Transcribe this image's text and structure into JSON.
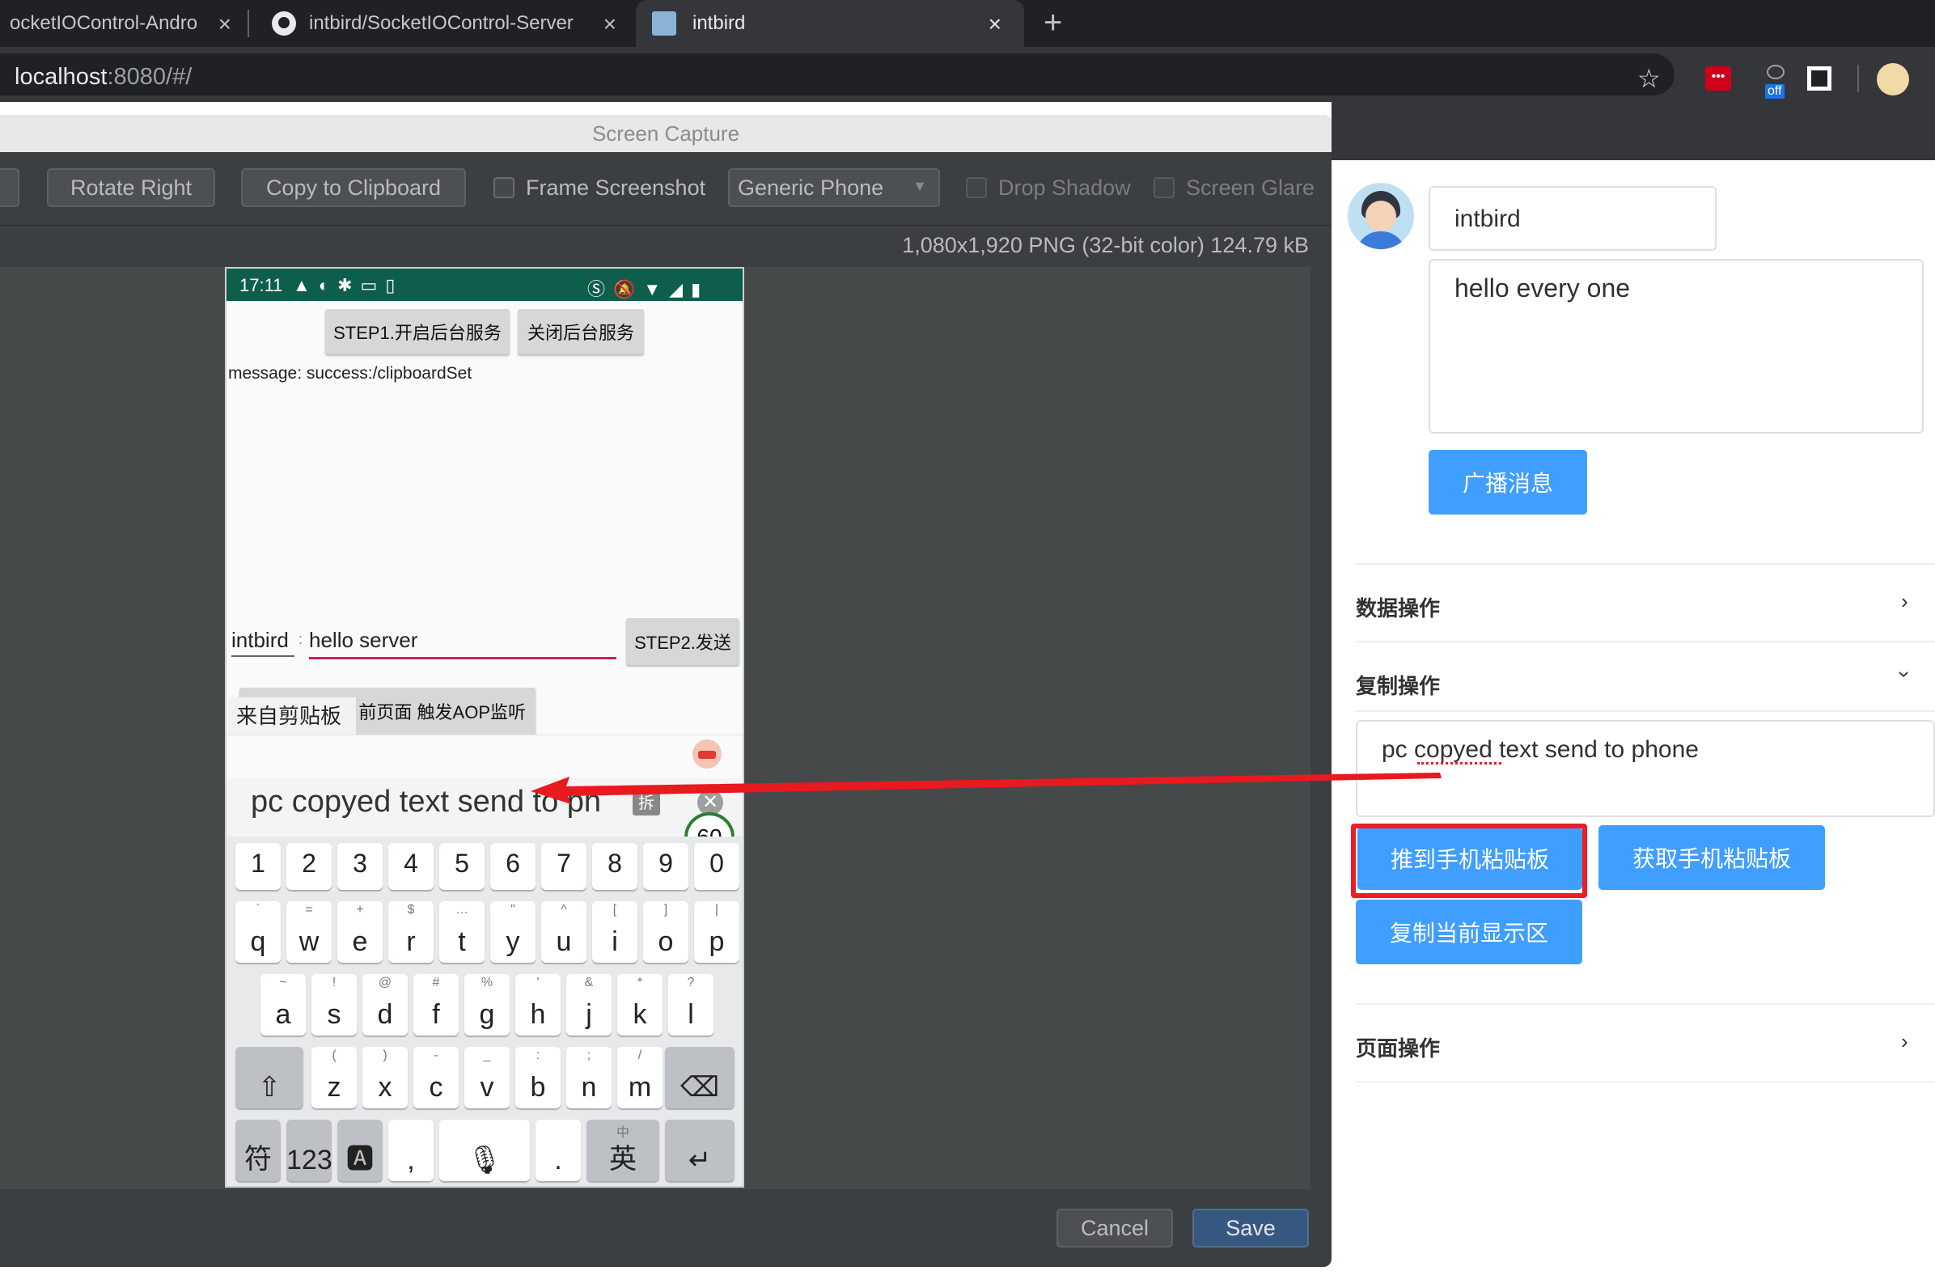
{
  "browser": {
    "tabs": [
      {
        "title": "ocketIOControl-Andro",
        "close": "×"
      },
      {
        "title": "intbird/SocketIOControl-Server",
        "close": "×"
      },
      {
        "title": "intbird",
        "close": "×"
      }
    ],
    "new_tab": "+",
    "url_host": "localhost",
    "url_rest": ":8080/#/",
    "ext_off_badge": "off"
  },
  "dialog": {
    "title": "Screen Capture",
    "toolbar": {
      "rotate_right": "Rotate Right",
      "copy_to_clipboard": "Copy to Clipboard",
      "frame_screenshot": "Frame Screenshot",
      "device_select": "Generic Phone",
      "drop_shadow": "Drop Shadow",
      "screen_glare": "Screen Glare"
    },
    "image_info": "1,080x1,920 PNG (32-bit color) 124.79 kB",
    "cancel": "Cancel",
    "save": "Save"
  },
  "phone": {
    "status_time": "17:11",
    "step1_button": "STEP1.开启后台服务",
    "close_service_button": "关闭后台服务",
    "message": "message: success:/clipboardSet",
    "name_field": "intbird",
    "separator": ":",
    "message_field": "hello server",
    "step2_button": "STEP2.发送",
    "aop_button": "前页面 触发AOP监听",
    "clipboard_label": "来自剪贴板",
    "clipboard_text": "pc copyed text send to ph",
    "split_badge": "拆",
    "counter": "60",
    "keyboard": {
      "num_row": [
        "1",
        "2",
        "3",
        "4",
        "5",
        "6",
        "7",
        "8",
        "9",
        "0"
      ],
      "row1": [
        {
          "k": "q",
          "s": "`"
        },
        {
          "k": "w",
          "s": "="
        },
        {
          "k": "e",
          "s": "+"
        },
        {
          "k": "r",
          "s": "$"
        },
        {
          "k": "t",
          "s": "…"
        },
        {
          "k": "y",
          "s": "\""
        },
        {
          "k": "u",
          "s": "^"
        },
        {
          "k": "i",
          "s": "["
        },
        {
          "k": "o",
          "s": "]"
        },
        {
          "k": "p",
          "s": "|"
        }
      ],
      "row2": [
        {
          "k": "a",
          "s": "~"
        },
        {
          "k": "s",
          "s": "!"
        },
        {
          "k": "d",
          "s": "@"
        },
        {
          "k": "f",
          "s": "#"
        },
        {
          "k": "g",
          "s": "%"
        },
        {
          "k": "h",
          "s": "'"
        },
        {
          "k": "j",
          "s": "&"
        },
        {
          "k": "k",
          "s": "*"
        },
        {
          "k": "l",
          "s": "?"
        }
      ],
      "row3": [
        {
          "k": "z",
          "s": "("
        },
        {
          "k": "x",
          "s": ")"
        },
        {
          "k": "c",
          "s": "-"
        },
        {
          "k": "v",
          "s": "_"
        },
        {
          "k": "b",
          "s": ":"
        },
        {
          "k": "n",
          "s": ";"
        },
        {
          "k": "m",
          "s": "/"
        }
      ],
      "symbol_key": "符",
      "num_key": "123",
      "comma_key": ",",
      "period_key": ".",
      "lang_key_top": "中",
      "lang_key_bottom": "英"
    }
  },
  "webpage": {
    "username": "intbird",
    "message": "hello every one",
    "broadcast_button": "广播消息",
    "section_data": "数据操作",
    "section_copy": "复制操作",
    "clipboard_input": "pc copyed text send to phone",
    "push_button": "推到手机粘贴板",
    "get_button": "获取手机粘贴板",
    "copy_screen_button": "复制当前显示区",
    "section_page": "页面操作"
  },
  "colors": {
    "accent": "#409eff",
    "highlight_box": "#ee1c25",
    "arrow": "#e8191f"
  }
}
